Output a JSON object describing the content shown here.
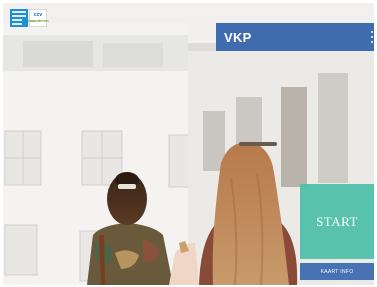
{
  "app": {
    "title": "VKP",
    "logo": {
      "name": "organization-logo",
      "badge_text": "ccv",
      "badge_subtext": "vlaanderen"
    }
  },
  "menu": {
    "icon": "kebab-menu-icon"
  },
  "background": {
    "description_icon": "photo-background"
  },
  "actions": {
    "start_label": "START",
    "info_label": "KAART INFO"
  },
  "colors": {
    "header_bar": "#3f6cae",
    "start_button": "#4fbfa8",
    "info_button": "#4773b4",
    "logo_blue": "#1f8fd3"
  }
}
